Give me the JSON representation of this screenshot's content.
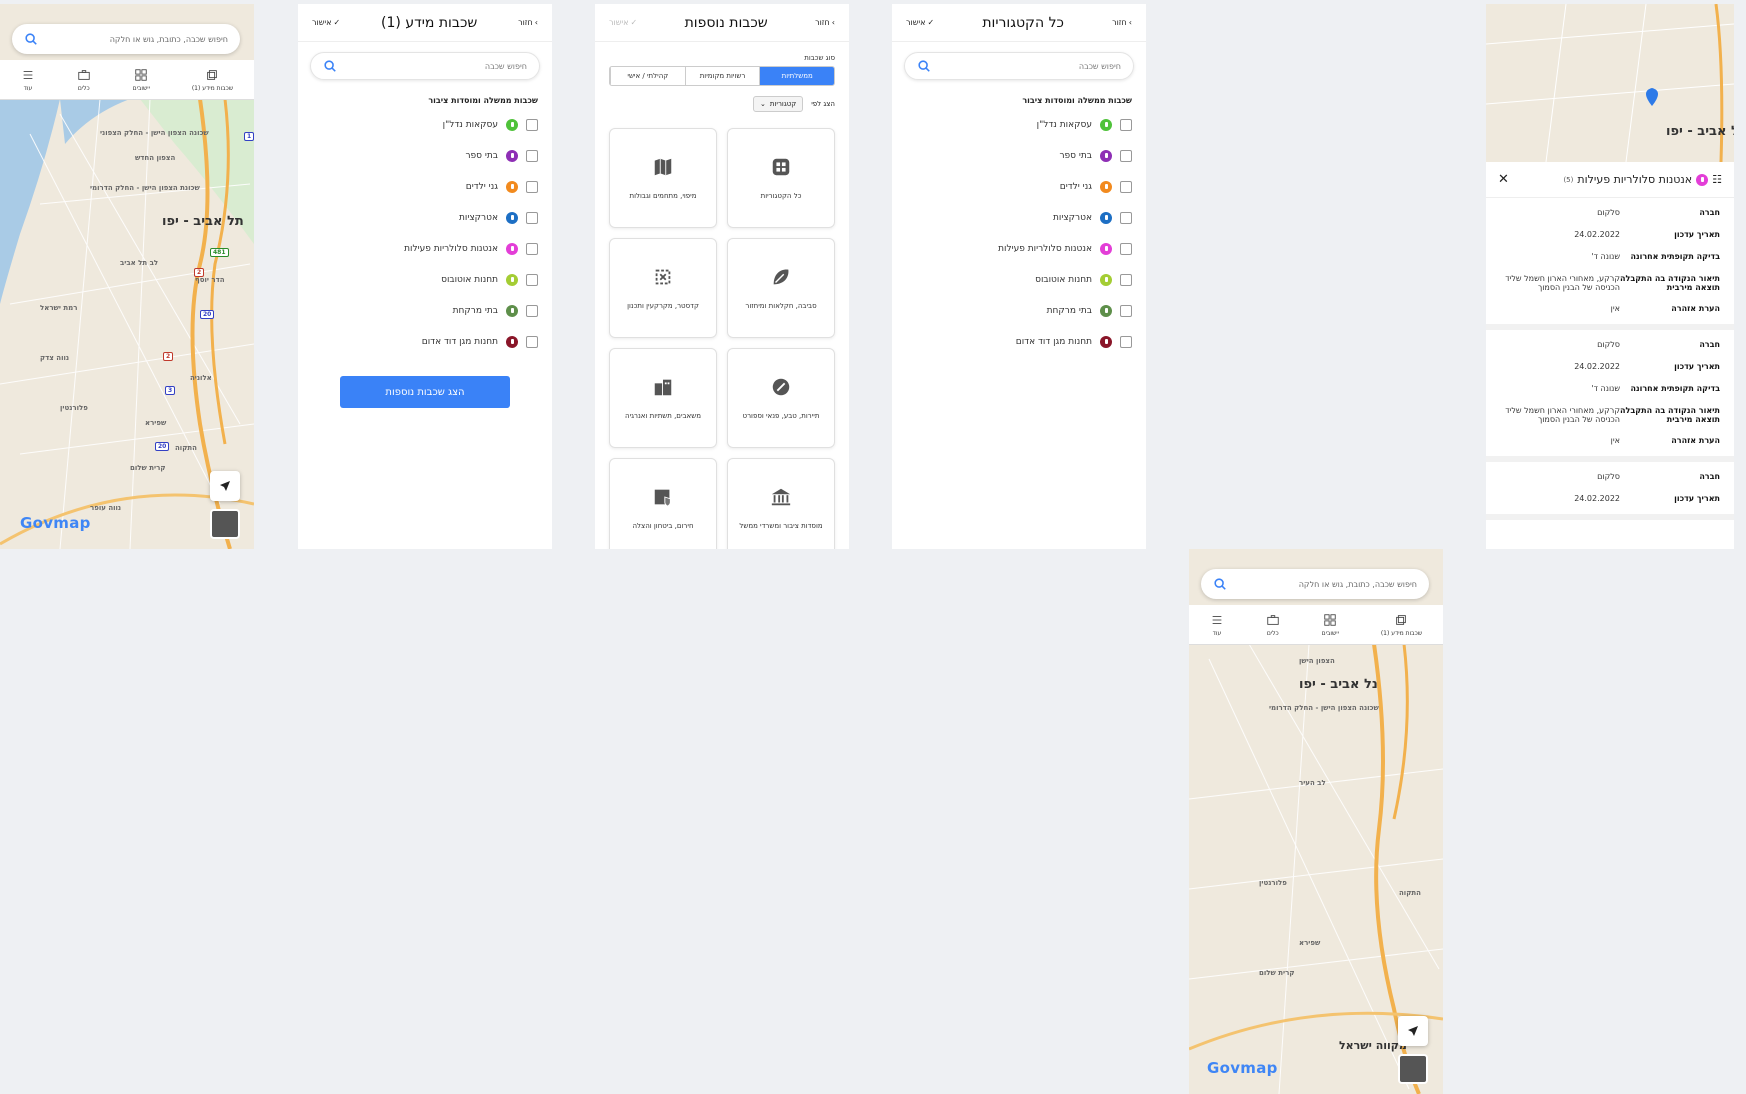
{
  "map_screen": {
    "search_placeholder": "חיפוש שכבה, כתובת, גוש או חלקה",
    "tabs": [
      {
        "label": "שכבות מידע (1)",
        "icon": "layers-icon"
      },
      {
        "label": "יישובים",
        "icon": "grid-icon"
      },
      {
        "label": "כלים",
        "icon": "briefcase-icon"
      },
      {
        "label": "עוד",
        "icon": "menu-icon"
      }
    ],
    "city_label": "תל אביב - יפו",
    "logo": "Govmap",
    "map_labels": [
      "שכונה הצפון הישן - החלק הצפוני",
      "הצפון החדש",
      "שכונת הצפון הישן - החלק הדרומי",
      "לב תל אביב",
      "הדר יוסף",
      "נווה צדק",
      "אלוניה",
      "שפירא",
      "התקוה",
      "קרית שלום",
      "נווה עופר",
      "רמת ישראל",
      "פלורנטין"
    ],
    "route_shields": [
      "481",
      "2",
      "20",
      "2",
      "3",
      "20",
      "1"
    ]
  },
  "layers_panel": {
    "title": "שכבות מידע (1)",
    "back_label": "חזור",
    "confirm_label": "אישור",
    "search_placeholder": "חיפוש שכבה",
    "section_title": "שכבות ממשלה ומוסדות ציבור",
    "items": [
      {
        "label": "עסקאות נדל\"ן",
        "color": "#4fc23a"
      },
      {
        "label": "בתי ספר",
        "color": "#8e2fb5"
      },
      {
        "label": "גני ילדים",
        "color": "#f28a1e"
      },
      {
        "label": "אטרקציות",
        "color": "#1d6fc4"
      },
      {
        "label": "אנטנות סלולריות פעילות",
        "color": "#e33ed7"
      },
      {
        "label": "תחנות אוטובוס",
        "color": "#a4cd34"
      },
      {
        "label": "בתי מרקחת",
        "color": "#5e8f4a"
      },
      {
        "label": "תחנות מגן דוד אדום",
        "color": "#8a1629"
      }
    ],
    "more_button": "הצג שכבות נוספות"
  },
  "more_layers_panel": {
    "title": "שכבות נוספות",
    "back_label": "חזור",
    "confirm_label": "אישור",
    "type_label": "סוג שכבות",
    "segments": [
      "ממשלתיות",
      "רשויות מקומיות",
      "קהילתי / אישי"
    ],
    "show_by_label": "הצג לפי",
    "dropdown_value": "קטגוריות",
    "cards": [
      {
        "label": "כל הקטגוריות",
        "icon": "apps-icon"
      },
      {
        "label": "מיפוי, מתחמים וגבולות",
        "icon": "map-icon"
      },
      {
        "label": "סביבה, חקלאות ומיחזור",
        "icon": "leaf-icon"
      },
      {
        "label": "קדסטר, מקרקעין ותכנון",
        "icon": "cadastre-icon"
      },
      {
        "label": "תיירות, טבע, פנאי וספורט",
        "icon": "tourism-icon"
      },
      {
        "label": "משאבים, תשתיות ואנרגיה",
        "icon": "infrastructure-icon"
      },
      {
        "label": "מוסדות ציבור ומשרדי ממשל",
        "icon": "government-icon"
      },
      {
        "label": "חירום, ביטחון והצלה",
        "icon": "emergency-icon"
      }
    ]
  },
  "categories_panel": {
    "title": "כל הקטגוריות",
    "back_label": "חזור",
    "confirm_label": "אישור",
    "search_placeholder": "חיפוש שכבה",
    "section_title": "שכבות ממשלה ומוסדות ציבור",
    "items": [
      {
        "label": "עסקאות נדל\"ן",
        "color": "#4fc23a"
      },
      {
        "label": "בתי ספר",
        "color": "#8e2fb5"
      },
      {
        "label": "גני ילדים",
        "color": "#f28a1e"
      },
      {
        "label": "אטרקציות",
        "color": "#1d6fc4"
      },
      {
        "label": "אנטנות סלולריות פעילות",
        "color": "#e33ed7"
      },
      {
        "label": "תחנות אוטובוס",
        "color": "#a4cd34"
      },
      {
        "label": "בתי מרקחת",
        "color": "#5e8f4a"
      },
      {
        "label": "תחנות מגן דוד אדום",
        "color": "#8a1629"
      }
    ]
  },
  "map_screen_2": {
    "search_placeholder": "חיפוש שכבה, כתובת, גוש או חלקה",
    "tabs": [
      {
        "label": "שכבות מידע (1)",
        "icon": "layers-icon"
      },
      {
        "label": "יישובים",
        "icon": "grid-icon"
      },
      {
        "label": "כלים",
        "icon": "briefcase-icon"
      },
      {
        "label": "עוד",
        "icon": "menu-icon"
      }
    ],
    "city_label": "נל אביב - יפו",
    "logo": "Govmap",
    "map_labels": [
      "הצפון הישן",
      "לב העיר",
      "פלורנטין",
      "שפירא",
      "התקוה",
      "קרית שלום",
      "מקווה ישראל",
      "שכונה הצפון הישן - החלק הדרומי"
    ]
  },
  "detail_panel": {
    "title": "אנטנות סלולריות פעילות",
    "count": "(5)",
    "map_city": "נל אביב - יפו",
    "records": [
      {
        "fields": [
          {
            "k": "חברה",
            "v": "סלקום"
          },
          {
            "k": "תאריך עדכון",
            "v": "24.02.2022"
          },
          {
            "k": "בדיקה תקופתית אחרונה",
            "v": "שנונה ד'"
          },
          {
            "k": "תיאור הנקודה בה התקבלה תוצאה מירבית",
            "v": "קרקע, מאחורי הארון חשמל שליד הכניסה של הבנין הסמוך"
          },
          {
            "k": "הערת אזהרה",
            "v": "אין"
          }
        ]
      },
      {
        "fields": [
          {
            "k": "חברה",
            "v": "סלקום"
          },
          {
            "k": "תאריך עדכון",
            "v": "24.02.2022"
          },
          {
            "k": "בדיקה תקופתית אחרונה",
            "v": "שנונה ד'"
          },
          {
            "k": "תיאור הנקודה בה התקבלה תוצאה מירבית",
            "v": "קרקע, מאחורי הארון חשמל שליד הכניסה של הבנין הסמוך"
          },
          {
            "k": "הערת אזהרה",
            "v": "אין"
          }
        ]
      },
      {
        "fields": [
          {
            "k": "חברה",
            "v": "סלקום"
          },
          {
            "k": "תאריך עדכון",
            "v": "24.02.2022"
          }
        ]
      }
    ]
  }
}
